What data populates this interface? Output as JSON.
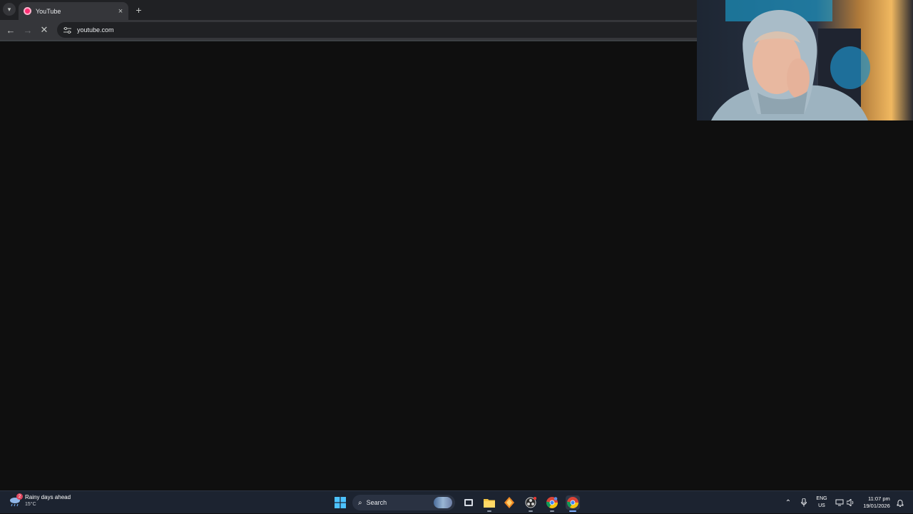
{
  "browser": {
    "tab": {
      "title": "YouTube",
      "favicon": "youtube-favicon-icon"
    },
    "new_tab_label": "+",
    "close_label": "×",
    "address": {
      "url": "youtube.com"
    },
    "colors": {
      "frame": "#202124",
      "toolbar": "#35363a",
      "page": "#0f0f0f"
    }
  },
  "taskbar": {
    "weather": {
      "title": "Rainy days ahead",
      "temperature": "15°C",
      "badge": "2"
    },
    "search": {
      "label": "Search"
    },
    "pinned_icons": [
      "windows-start-icon",
      "search-icon",
      "task-view-icon",
      "file-explorer-icon",
      "app-icon",
      "obs-icon",
      "chrome-icon",
      "chrome-icon"
    ],
    "language": {
      "line1": "ENG",
      "line2": "US"
    },
    "clock": {
      "time": "11:07 pm",
      "date": "19/01/2026"
    },
    "colors": {
      "bar": "#1c2330",
      "accent": "#7fb0ff"
    }
  }
}
